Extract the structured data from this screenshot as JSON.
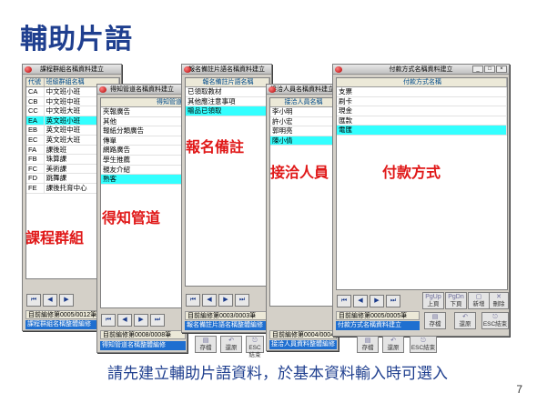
{
  "slide": {
    "title": "輔助片語",
    "caption": "請先建立輔助片語資料，於基本資料輸入時可選入",
    "page_number": "7"
  },
  "win_course": {
    "title": "課程群組名稱資料建立",
    "columns": [
      "代號",
      "班級群組名稱"
    ],
    "rows": [
      [
        "CA",
        "中文班小班"
      ],
      [
        "CB",
        "中文班中班"
      ],
      [
        "CC",
        "中文班大班"
      ],
      [
        "EA",
        "英文班小班"
      ],
      [
        "EB",
        "英文班中班"
      ],
      [
        "EC",
        "英文班大班"
      ],
      [
        "FA",
        "課後班"
      ],
      [
        "FB",
        "珠算課"
      ],
      [
        "FC",
        "美術課"
      ],
      [
        "FD",
        "跳舞課"
      ],
      [
        "FE",
        "課後托育中心"
      ]
    ],
    "selected_index": 3,
    "status": "目前編修第0005/0012筆",
    "form_name": "課程群組名稱整體編修",
    "overlay": "課程群組"
  },
  "win_source": {
    "title": "得知管道名稱資料建立",
    "column": "得知管道",
    "rows": [
      "夾報廣告",
      "其他",
      "報紙分類廣告",
      "傳單",
      "網路廣告",
      "學生推薦",
      "親友介紹",
      "熟客"
    ],
    "selected_index": 7,
    "status": "目前編修第0008/0008筆",
    "form_name": "得知管道名稱整體編修",
    "overlay": "得知管道"
  },
  "win_note": {
    "title": "報名備註片語名稱資料建立",
    "column": "報名備註片語名稱",
    "rows": [
      "已領取教材",
      "其他應注意事項",
      "贈品已領取"
    ],
    "selected_index": 2,
    "status": "目前編修第0003/0003筆",
    "form_name": "報名備註片語名稱整體編修",
    "overlay": "報名備註"
  },
  "win_contact": {
    "title": "接洽人員名稱資料建立",
    "column": "接洽人員名稱",
    "rows": [
      "李小明",
      "許小宏",
      "郭明亮",
      "陳小倩"
    ],
    "selected_index": 3,
    "status": "目前編修第0004/0004筆",
    "form_name": "接洽人員資料整體編修",
    "overlay": "接洽人員"
  },
  "win_pay": {
    "title": "付款方式名稱資料建立",
    "column": "付款方式名稱",
    "rows": [
      "支票",
      "刷卡",
      "現金",
      "匯款",
      "電匯"
    ],
    "selected_index": 4,
    "status": "目前編修第0005/0005筆",
    "form_name": "付款方式名稱資料建立",
    "overlay": "付款方式",
    "buttons": {
      "pgup": "PgUp",
      "pgup_sub": "上頁",
      "pgdn": "PgDn",
      "pgdn_sub": "下頁",
      "new": "新增",
      "delete": "刪除",
      "save": "存檔",
      "undo": "還原",
      "exit": "ESC結束"
    }
  },
  "shared_buttons": {
    "save": "存檔",
    "undo": "還原",
    "exit": "ESC結束"
  },
  "nav_glyphs": {
    "first": "⏮",
    "prev": "◀",
    "next": "▶",
    "last": "⏭"
  },
  "colors": {
    "title_blue": "#1f3f8f",
    "overlay_red": "#e01818",
    "selection_cyan": "#33ffff",
    "form_name_blue": "#1f6fd0"
  }
}
